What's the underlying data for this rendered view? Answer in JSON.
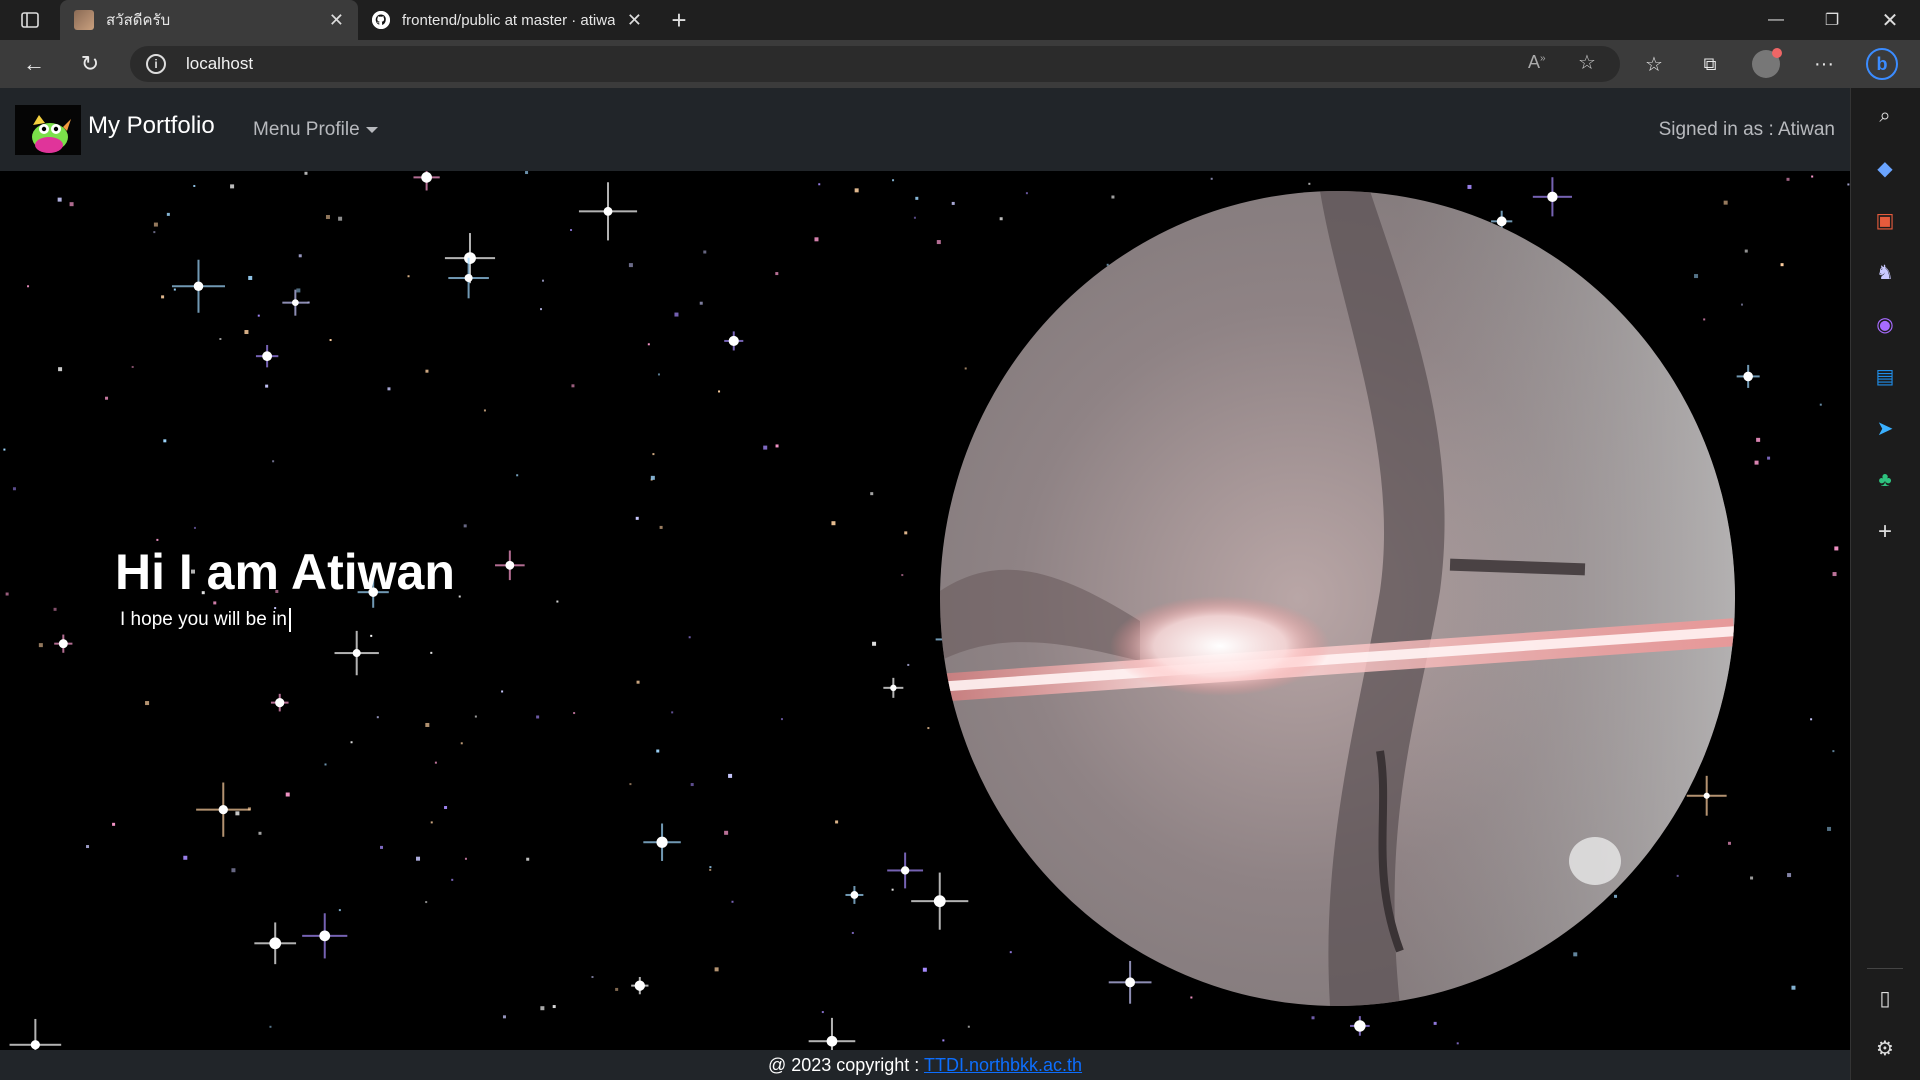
{
  "browser": {
    "tabs": [
      {
        "title": "สวัสดีครับ",
        "active": true
      },
      {
        "title": "frontend/public at master · atiwa",
        "active": false
      }
    ],
    "url": "localhost",
    "icons": [
      "tab-actions-icon",
      "back-icon",
      "reload-icon",
      "info-icon",
      "read-aloud-icon",
      "add-favorite-icon",
      "favorites-icon",
      "collections-icon",
      "profile-icon",
      "more-icon",
      "bing-icon"
    ],
    "sidebar_icons": [
      "search-icon",
      "shopping-icon",
      "tools-icon",
      "games-icon",
      "office-icon",
      "outlook-icon",
      "drop-icon",
      "tree-icon",
      "add-icon",
      "split-screen-icon",
      "settings-icon"
    ]
  },
  "navbar": {
    "brand": "My Portfolio",
    "menu": "Menu Profile",
    "signed_in_label": "Signed in as : ",
    "signed_in_name": "Atiwan"
  },
  "hero": {
    "title": "Hi I am Atiwan",
    "subtitle": "I hope you will be in"
  },
  "footer": {
    "text": "@ 2023 copyright : ",
    "link": "TTDI.northbkk.ac.th",
    "link_color": "#0d6efd"
  },
  "colors": {
    "navbar_bg": "#212529",
    "page_bg": "#000000",
    "chrome_bg": "#3b3b3b"
  }
}
